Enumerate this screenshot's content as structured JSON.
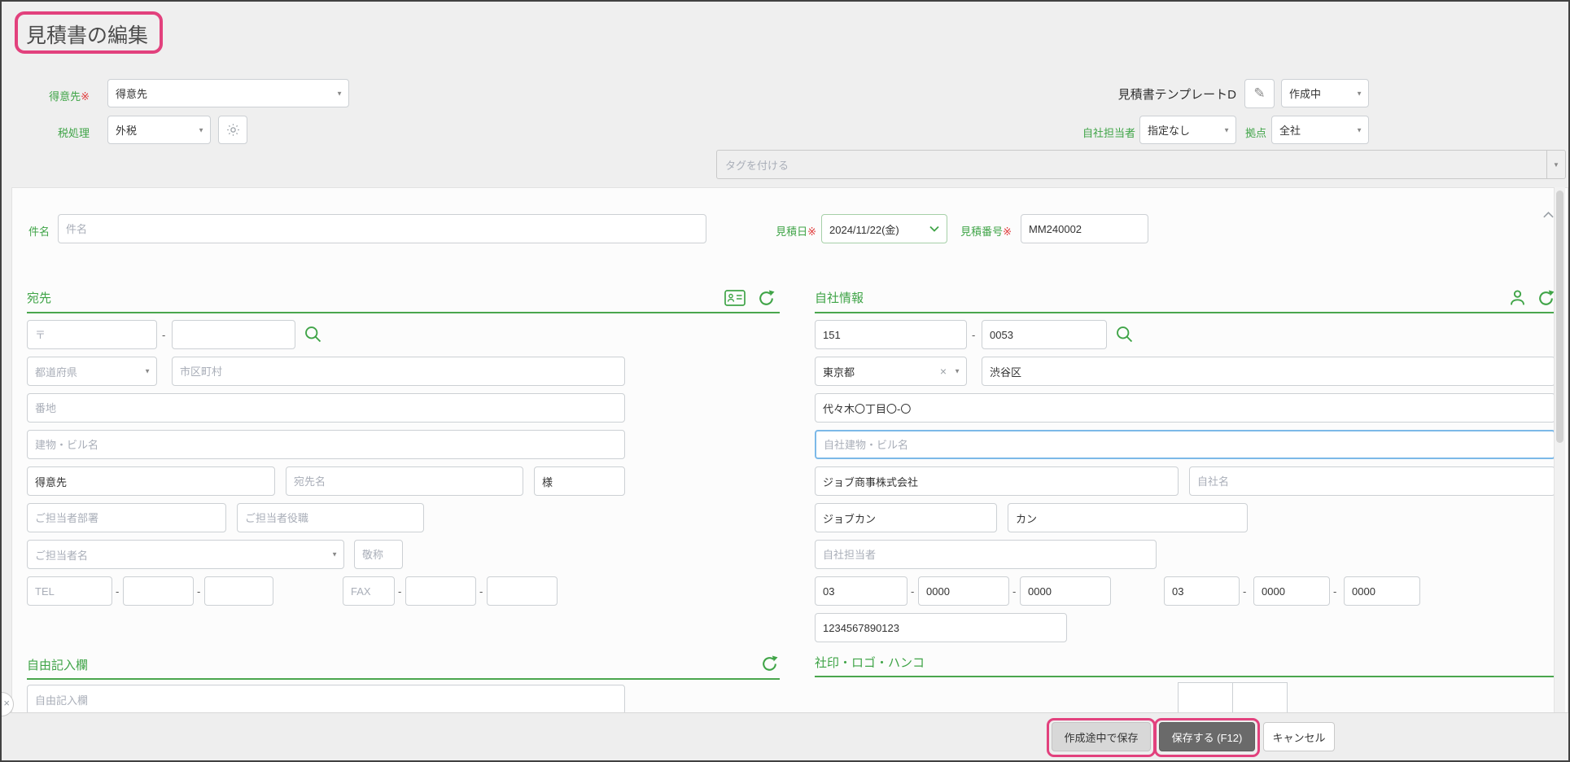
{
  "window": {
    "title": "見積書の編集"
  },
  "misc": {
    "dash": "-",
    "required": "※"
  },
  "icons": {
    "dropdown": "▼",
    "clear": "×",
    "collapse": "×",
    "pencil": "✎"
  },
  "colors": {
    "accent_green": "#3fa447",
    "annotation_pink": "#e2417d",
    "required_red": "#e03c3c",
    "focus_blue": "#7cb9e8"
  },
  "top": {
    "customer": {
      "label": "得意先",
      "value": "得意先"
    },
    "tax": {
      "label": "税処理",
      "value": "外税"
    },
    "template": {
      "name": "見積書テンプレートD"
    },
    "status": {
      "value": "作成中"
    },
    "staff": {
      "label": "自社担当者",
      "value": "指定なし"
    },
    "branch": {
      "label": "拠点",
      "value": "全社"
    },
    "tag": {
      "placeholder": "タグを付ける"
    }
  },
  "quote": {
    "subject": {
      "label": "件名",
      "placeholder": "件名"
    },
    "date": {
      "label": "見積日",
      "value": "2024/11/22(金)"
    },
    "number": {
      "label": "見積番号",
      "value": "MM240002"
    }
  },
  "recipient": {
    "title": "宛先",
    "postal_placeholder": "〒",
    "prefecture_placeholder": "都道府県",
    "city_placeholder": "市区町村",
    "street_placeholder": "番地",
    "building_placeholder": "建物・ビル名",
    "company_value": "得意先",
    "addressee_placeholder": "宛先名",
    "honorific_value": "様",
    "department_placeholder": "ご担当者部署",
    "role_placeholder": "ご担当者役職",
    "person_placeholder": "ご担当者名",
    "salutation_placeholder": "敬称",
    "tel_placeholder": "TEL",
    "fax_placeholder": "FAX"
  },
  "company": {
    "title": "自社情報",
    "postal1": "151",
    "postal2": "0053",
    "prefecture": "東京都",
    "city": "渋谷区",
    "street": "代々木〇丁目〇-〇",
    "building_placeholder": "自社建物・ビル名",
    "name": "ジョブ商事株式会社",
    "name_placeholder": "自社名",
    "kana1": "ジョブカン",
    "kana2": "カン",
    "staff_placeholder": "自社担当者",
    "tel1": "03",
    "tel2": "0000",
    "tel3": "0000",
    "fax1": "03",
    "fax2": "0000",
    "fax3": "0000",
    "invoice_number": "1234567890123"
  },
  "free_note": {
    "title": "自由記入欄",
    "placeholder": "自由記入欄"
  },
  "stamp": {
    "title": "社印・ロゴ・ハンコ"
  },
  "footer": {
    "save_draft": "作成途中で保存",
    "save": "保存する (F12)",
    "cancel": "キャンセル"
  }
}
